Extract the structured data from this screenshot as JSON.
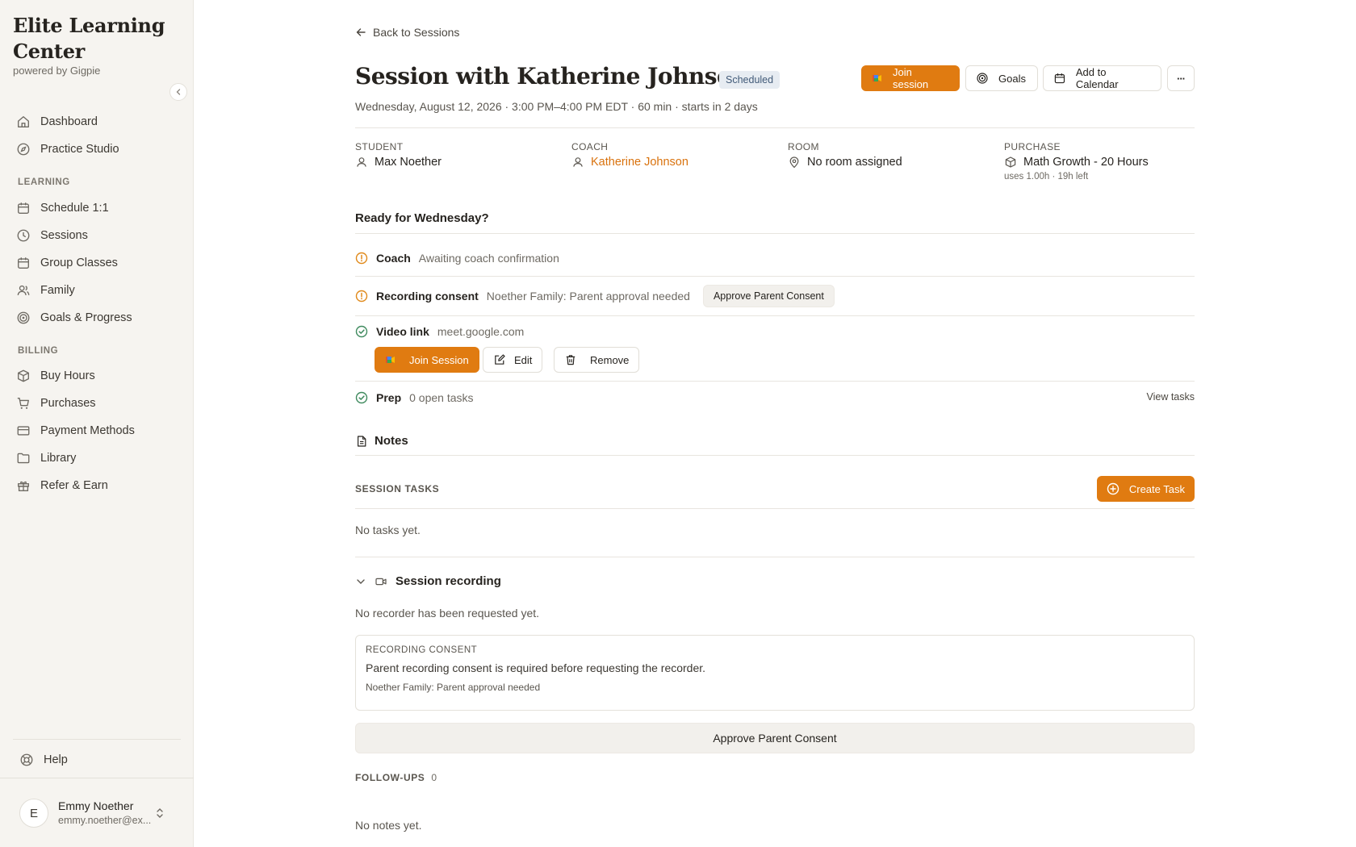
{
  "sidebar": {
    "brand": "Elite Learning Center",
    "powered_by": "powered by Gigpie",
    "items": [
      {
        "label": "Dashboard",
        "icon": "home-icon"
      },
      {
        "label": "Practice Studio",
        "icon": "compass-icon"
      },
      {
        "label": "Schedule 1:1",
        "icon": "calendar-icon"
      },
      {
        "label": "Sessions",
        "icon": "clock-icon"
      },
      {
        "label": "Group Classes",
        "icon": "calendar-icon"
      },
      {
        "label": "Family",
        "icon": "users-icon"
      },
      {
        "label": "Goals & Progress",
        "icon": "target-icon"
      },
      {
        "label": "Buy Hours",
        "icon": "package-icon"
      },
      {
        "label": "Purchases",
        "icon": "cart-icon"
      },
      {
        "label": "Payment Methods",
        "icon": "card-icon"
      },
      {
        "label": "Library",
        "icon": "folder-icon"
      },
      {
        "label": "Refer & Earn",
        "icon": "gift-icon"
      }
    ],
    "sections": {
      "learning": "LEARNING",
      "billing": "BILLING"
    },
    "help": "Help",
    "user": {
      "initial": "E",
      "name": "Emmy Noether",
      "email": "emmy.noether@ex..."
    }
  },
  "header": {
    "back": "Back to Sessions",
    "title": "Session with Katherine Johnson",
    "status": "Scheduled",
    "subtitle": "Wednesday, August 12, 2026 · 3:00 PM–4:00 PM EDT · 60 min · starts in 2 days",
    "join": "Join session",
    "goals": "Goals",
    "calendar": "Add to Calendar",
    "more": "···"
  },
  "info": {
    "student_label": "STUDENT",
    "student": "Max Noether",
    "coach_label": "COACH",
    "coach": "Katherine Johnson",
    "room_label": "ROOM",
    "room": "No room assigned",
    "purchase_label": "PURCHASE",
    "purchase": "Math Growth - 20 Hours",
    "purchase_note": "uses 1.00h · 19h left"
  },
  "ready": {
    "heading": "Ready for Wednesday?",
    "coach_label": "Coach",
    "coach_value": "Awaiting coach confirmation",
    "consent_label": "Recording consent",
    "consent_value": "Noether Family: Parent approval needed",
    "consent_btn": "Approve Parent Consent",
    "video_label": "Video link",
    "video_value": "meet.google.com",
    "join": "Join Session",
    "edit": "Edit",
    "remove": "Remove",
    "prep_label": "Prep",
    "prep_value": "0 open tasks",
    "view_tasks": "View tasks"
  },
  "notes": {
    "heading": "Notes",
    "tasks_title": "SESSION TASKS",
    "create_task": "Create Task",
    "no_tasks": "No tasks yet.",
    "recording_title": "Session recording",
    "no_recorder": "No recorder has been requested yet.",
    "consent_box_title": "RECORDING CONSENT",
    "consent_box_text": "Parent recording consent is required before requesting the recorder.",
    "consent_box_sub": "Noether Family: Parent approval needed",
    "approve_btn": "Approve Parent Consent",
    "followups_label": "FOLLOW-UPS",
    "followups_count": "0",
    "no_notes": "No notes yet."
  },
  "colors": {
    "accent": "#e07b11",
    "coach_link": "#d9720d",
    "warn": "#e0891a",
    "ok": "#3f8a5e"
  }
}
